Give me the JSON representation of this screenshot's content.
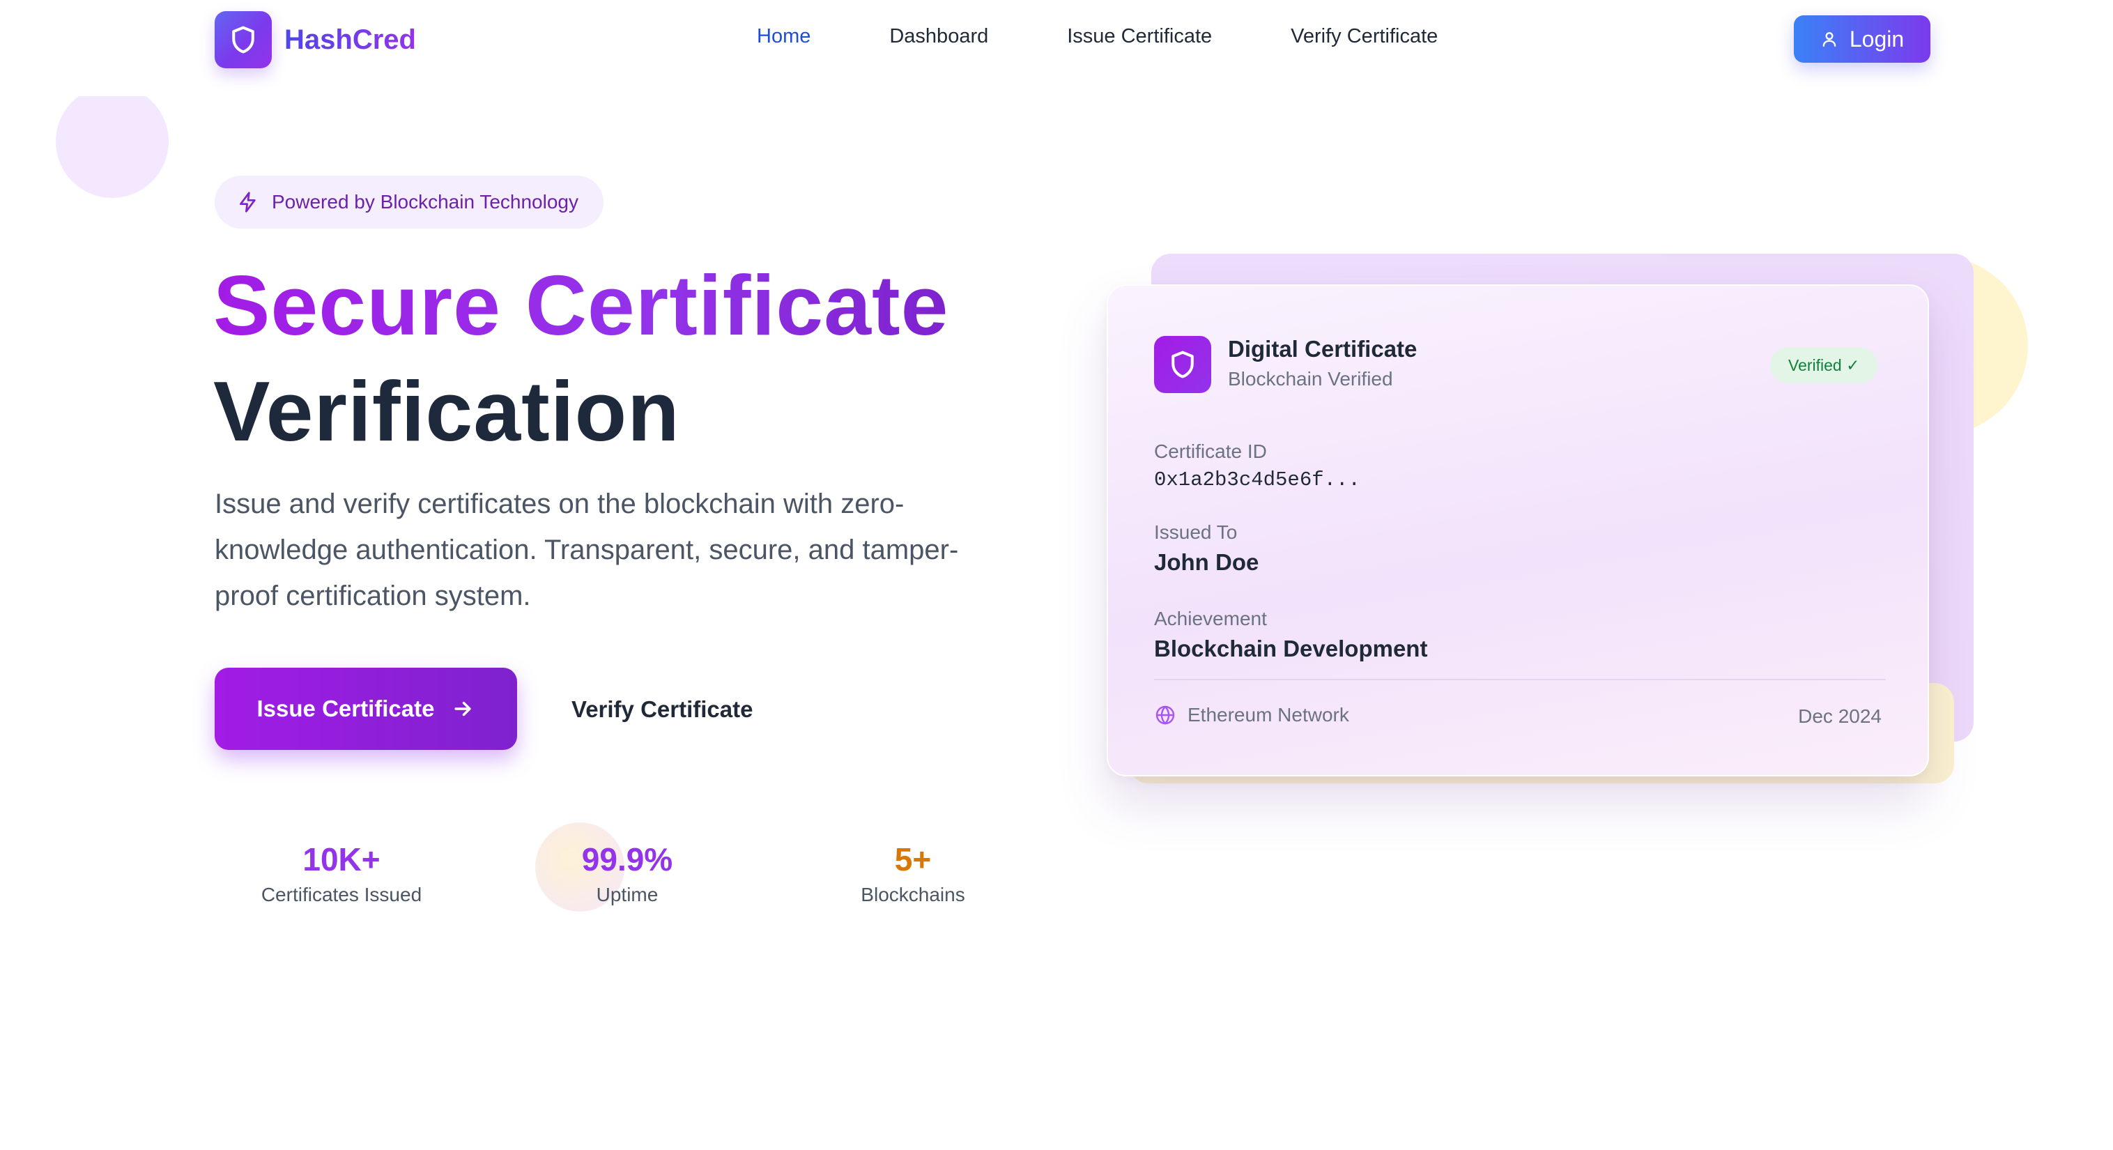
{
  "brand": {
    "name": "HashCred",
    "logo_icon": "shield-icon"
  },
  "nav": {
    "links": [
      {
        "label": "Home",
        "active": true
      },
      {
        "label": "Dashboard",
        "active": false
      },
      {
        "label": "Issue Certificate",
        "active": false
      },
      {
        "label": "Verify Certificate",
        "active": false
      }
    ],
    "login_label": "Login",
    "login_icon": "user-icon"
  },
  "hero": {
    "badge_text": "Powered by Blockchain Technology",
    "badge_icon": "lightning-icon",
    "title_line1": "Secure Certificate",
    "title_line2": "Verification",
    "description": "Issue and verify certificates on the blockchain with zero-knowledge authentication. Transparent, secure, and tamper-proof certification system.",
    "primary_cta": "Issue Certificate",
    "primary_cta_icon": "arrow-right-icon",
    "secondary_cta": "Verify Certificate"
  },
  "stats": [
    {
      "value": "10K+",
      "label": "Certificates Issued",
      "color": "#9333ea"
    },
    {
      "value": "99.9%",
      "label": "Uptime",
      "color": "#9333ea"
    },
    {
      "value": "5+",
      "label": "Blockchains",
      "color": "#d97706"
    }
  ],
  "certificate": {
    "title": "Digital Certificate",
    "subtitle": "Blockchain Verified",
    "status": "Verified ✓",
    "id_label": "Certificate ID",
    "id_value": "0x1a2b3c4d5e6f...",
    "issued_to_label": "Issued To",
    "issued_to_value": "John Doe",
    "achievement_label": "Achievement",
    "achievement_value": "Blockchain Development",
    "network": "Ethereum Network",
    "network_icon": "globe-icon",
    "date": "Dec 2024"
  },
  "colors": {
    "brand_purple": "#9333ea",
    "brand_indigo": "#4f46e5",
    "nav_active": "#1d4ed8",
    "verified_green": "#15803d"
  }
}
